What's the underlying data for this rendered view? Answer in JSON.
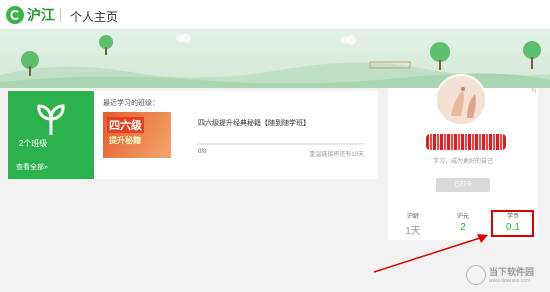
{
  "header": {
    "logo_text": "沪江",
    "page_title": "个人主页"
  },
  "colors": {
    "brand_green": "#2cb24c",
    "highlight_red": "#e00000"
  },
  "classes": {
    "count_label": "2个班级",
    "view_all": "查看全部»",
    "recent_label": "最近学习的班级：",
    "course": {
      "thumb_line1": "四六级",
      "thumb_line2": "提升秘籍",
      "title": "四六级提升经典秘籍【随到随学班】",
      "progress_text": "0/8",
      "progress_fraction": 0,
      "status_text": "重温链接将还有10天"
    }
  },
  "profile": {
    "corner_tag": "hj",
    "motto": "学习，成为更好的自己",
    "signin_label": "已打卡",
    "stats": [
      {
        "label": "沪龄",
        "value": "1天",
        "color": "#999999"
      },
      {
        "label": "沪元",
        "value": "2",
        "color": "#2cb24c"
      },
      {
        "label": "学币",
        "value": "0.1",
        "color": "#2cb24c"
      }
    ]
  },
  "watermark": {
    "main": "当下软件园",
    "sub": "www.downxia.com"
  }
}
